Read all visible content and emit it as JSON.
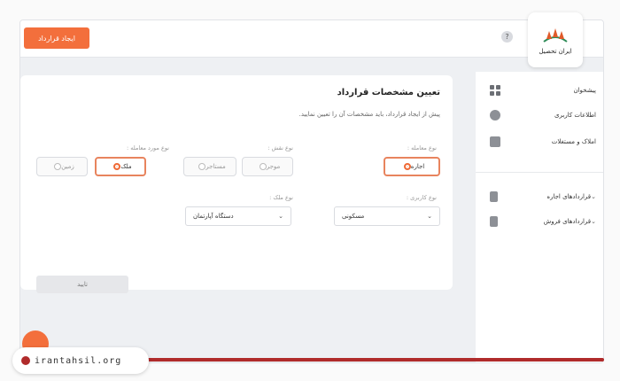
{
  "header": {
    "create_button": "ایجاد قرارداد",
    "help_icon": "?"
  },
  "logo": {
    "text": "ایران تحصیل"
  },
  "sidebar": {
    "items": [
      {
        "label": "پیشخوان",
        "icon": "dashboard-icon"
      },
      {
        "label": "اطلاعات کاربری",
        "icon": "user-icon"
      },
      {
        "label": "املاک و مستغلات",
        "icon": "building-icon"
      },
      {
        "label": "قراردادهای اجاره",
        "icon": "document-icon",
        "chevron": "⌄"
      },
      {
        "label": "قراردادهای فروش",
        "icon": "document-icon",
        "chevron": "⌄"
      }
    ]
  },
  "form": {
    "title": "تعیین مشخصات قرارداد",
    "subtitle": "پیش از ایجاد قرارداد، باید مشخصات آن را تعیین نمایید.",
    "transaction_type": {
      "label": "نوع معامله :",
      "options": [
        "اجاره"
      ],
      "selected": "اجاره"
    },
    "role_type": {
      "label": "نوع نقش :",
      "options": [
        "موجر",
        "مستاجر"
      ]
    },
    "deal_item_type": {
      "label": "نوع مورد معامله :",
      "options": [
        "ملک",
        "زمین"
      ],
      "selected": "ملک"
    },
    "usage_type": {
      "label": "نوع کاربری :",
      "value": "مسکونی"
    },
    "property_type": {
      "label": "نوع ملک :",
      "value": "دستگاه آپارتمان"
    },
    "confirm_button": "تایید"
  },
  "footer": {
    "website": "irantahsil.org"
  },
  "colors": {
    "accent": "#f36f3c",
    "brand_red": "#b02b2b"
  }
}
